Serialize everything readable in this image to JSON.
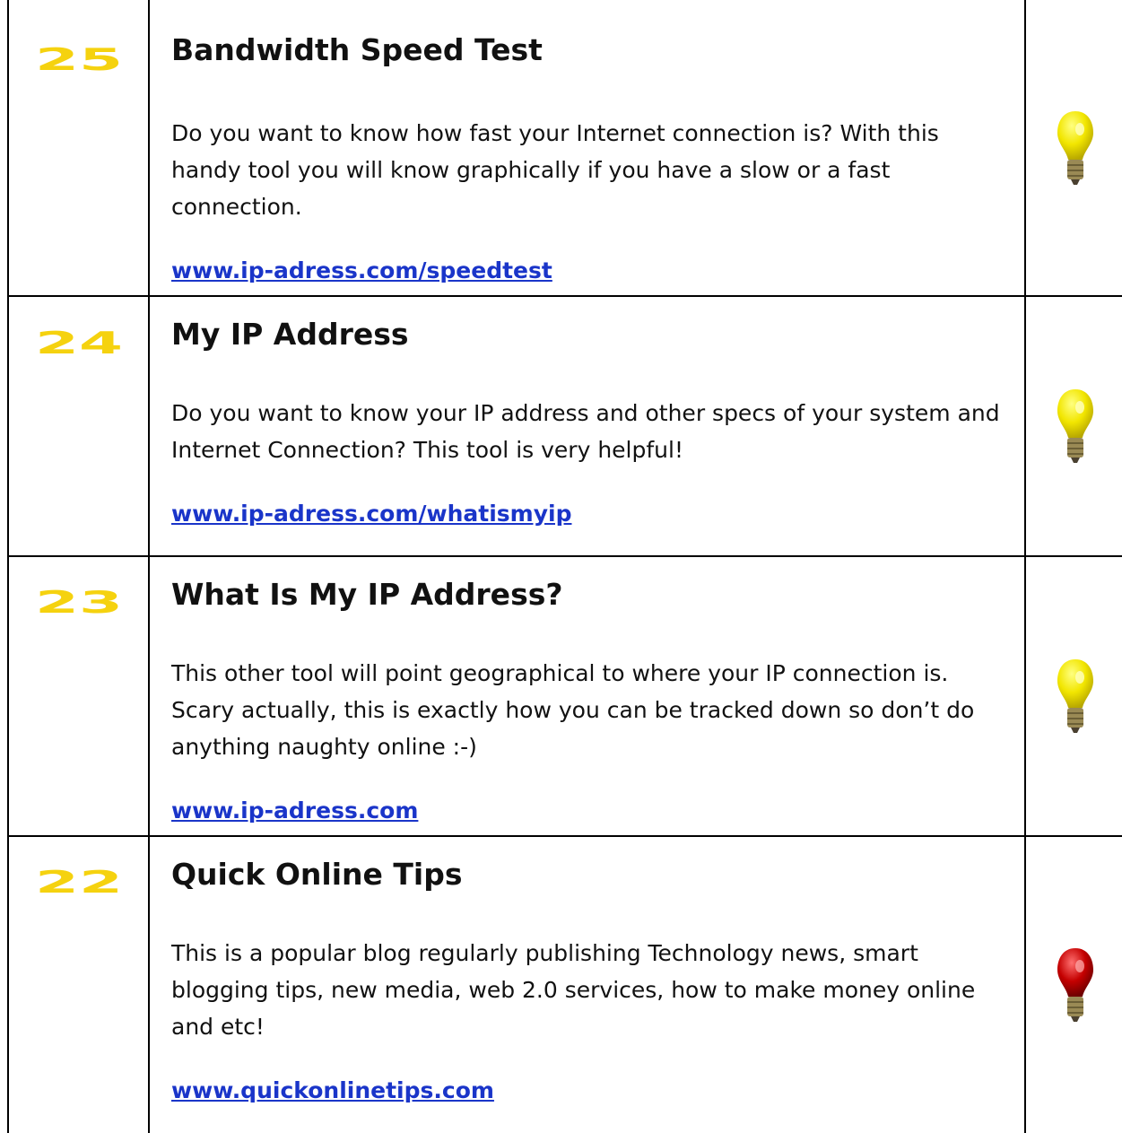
{
  "items": [
    {
      "rank": "25",
      "title": "Bandwidth Speed Test",
      "description": "Do you want to know how fast your Internet connection is? With this handy tool you will know graphically if you have a slow or a fast connection.",
      "link": "www.ip-adress.com/speedtest",
      "bulb_color": "yellow"
    },
    {
      "rank": "24",
      "title": "My IP Address",
      "description": "Do you want to know your IP address and other specs of your system and Internet Connection? This tool is very helpful!",
      "link": "www.ip-adress.com/whatismyip",
      "bulb_color": "yellow"
    },
    {
      "rank": "23",
      "title": "What Is My IP Address?",
      "description": "This other tool will point geographical to where your IP connection is. Scary actually, this is exactly how you can be tracked down so don’t do anything naughty online :-)",
      "link": "www.ip-adress.com",
      "bulb_color": "yellow"
    },
    {
      "rank": "22",
      "title": "Quick Online Tips",
      "description": "This is a popular blog regularly publishing Technology news, smart blogging tips, new media, web 2.0 services, how to make money online and etc!",
      "link": "www.quickonlinetips.com",
      "bulb_color": "red"
    }
  ],
  "colors": {
    "rank_yellow": "#f5d20f",
    "link_blue": "#1a35c9",
    "bulb_yellow": "#f2e600",
    "bulb_red": "#c40000"
  }
}
